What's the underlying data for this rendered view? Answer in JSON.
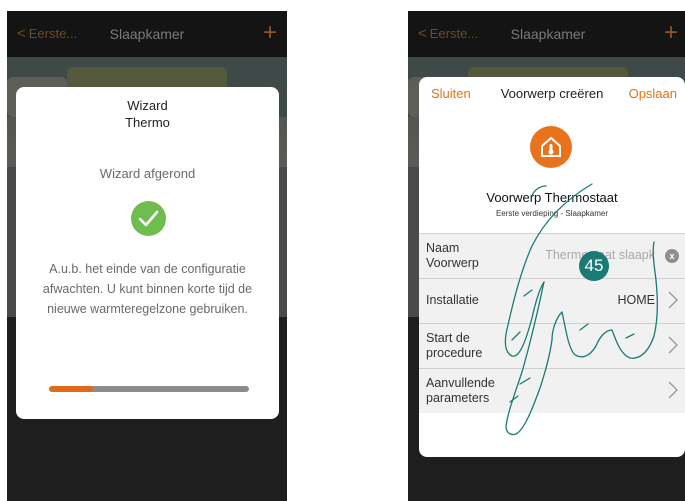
{
  "left": {
    "topbar": {
      "back_label": "Eerste...",
      "title": "Slaapkamer",
      "add_glyph": "+"
    },
    "dialog": {
      "title_line1": "Wizard",
      "title_line2": "Thermo",
      "status": "Wizard afgerond",
      "status_icon": "check-icon",
      "message": "A.u.b. het einde van de configuratie afwachten. U kunt binnen korte tijd de nieuwe warmteregelzone gebruiken.",
      "progress_fraction": 0.22
    }
  },
  "right": {
    "topbar": {
      "back_label": "Eerste...",
      "title": "Slaapkamer",
      "add_glyph": "+"
    },
    "dialog": {
      "close_label": "Sluiten",
      "title": "Voorwerp creëren",
      "save_label": "Opslaan",
      "object_icon": "thermostat-house-icon",
      "object_name": "Voorwerp Thermostaat",
      "object_location": "Eerste verdieping - Slaapkamer",
      "rows": [
        {
          "label": "Naam Voorwerp",
          "value": "Thermostaat slaapk",
          "action_icon": "clear-icon"
        },
        {
          "label": "Installatie",
          "value": "HOME",
          "action_icon": "chevron-right-icon"
        },
        {
          "label": "Start de procedure",
          "value": "",
          "action_icon": "chevron-right-icon"
        },
        {
          "label": "Aanvullende parameters",
          "value": "",
          "action_icon": "chevron-right-icon"
        }
      ]
    }
  },
  "step_badge": "45",
  "colors": {
    "accent": "#e07418",
    "success": "#6ebd4e",
    "badge": "#1b7a76"
  }
}
